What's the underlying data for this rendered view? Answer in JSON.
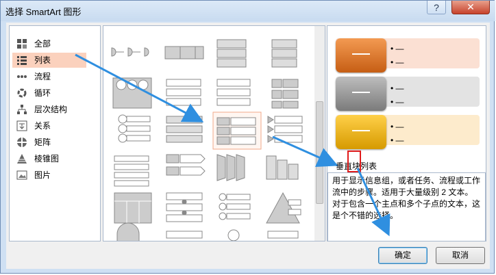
{
  "title": "选择 SmartArt 图形",
  "titlebar": {
    "help": "?",
    "close": "✕"
  },
  "categories": [
    {
      "label": "全部",
      "icon": "grid-icon"
    },
    {
      "label": "列表",
      "icon": "list-icon"
    },
    {
      "label": "流程",
      "icon": "process-icon"
    },
    {
      "label": "循环",
      "icon": "cycle-icon"
    },
    {
      "label": "层次结构",
      "icon": "hierarchy-icon"
    },
    {
      "label": "关系",
      "icon": "relationship-icon"
    },
    {
      "label": "矩阵",
      "icon": "matrix-icon"
    },
    {
      "label": "棱锥图",
      "icon": "pyramid-icon"
    },
    {
      "label": "图片",
      "icon": "picture-icon"
    }
  ],
  "selected_category": "列表",
  "preview": {
    "name": "垂直块列表",
    "description": "用于显示信息组，或者任务、流程或工作流中的步骤。适用于大量级别 2 文本。对于包含一个主点和多个子点的文本，这是个不错的选择。",
    "block_text": "—",
    "bullet_text": "• —",
    "colors": {
      "orange": "#e07c2a",
      "gray": "#9a9a9a",
      "gold": "#f0b400"
    }
  },
  "buttons": {
    "ok": "确定",
    "cancel": "取消"
  },
  "accent": "#2f8fe0"
}
